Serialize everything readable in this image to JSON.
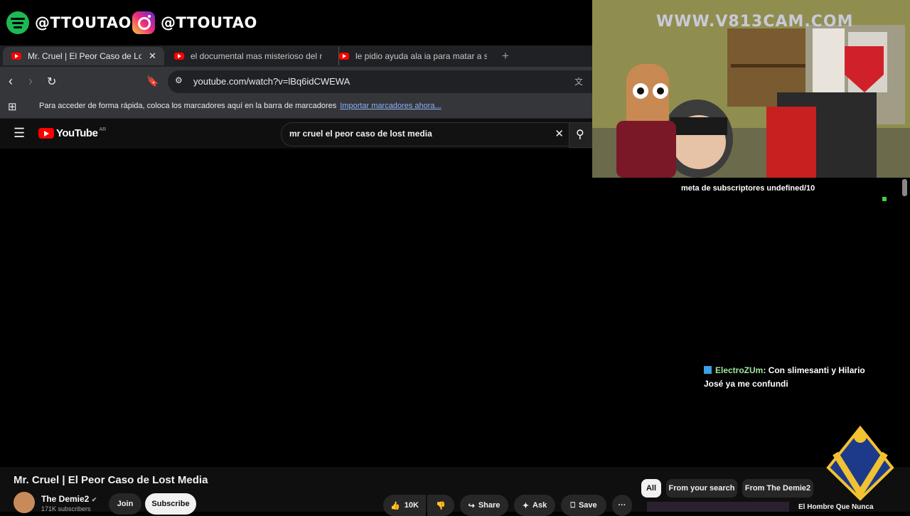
{
  "overlay": {
    "spotify_handle": "@TTOUTAO",
    "instagram_handle": "@TTOUTAO",
    "webcam_watermark": "WWW.V813CAM.COM",
    "sub_goal": "meta de subscriptores undefined/10"
  },
  "browser": {
    "tabs": [
      {
        "title": "Mr. Cruel | El Peor Caso de Lost M",
        "active": true
      },
      {
        "title": "el documental mas misterioso del m",
        "active": false
      },
      {
        "title": "le pidio ayuda ala ia para matar a su",
        "active": false
      }
    ],
    "new_tab": "+",
    "url": "youtube.com/watch?v=lBq6idCWEWA",
    "bookmarks_hint": "Para acceder de forma rápida, coloca los marcadores aquí en la barra de marcadores",
    "bookmarks_import": "Importar marcadores ahora..."
  },
  "youtube": {
    "logo_text": "YouTube",
    "logo_region": "AR",
    "search_query": "mr cruel el peor caso de lost media",
    "video_title": "Mr. Cruel | El Peor Caso de Lost Media",
    "channel_name": "The Demie2",
    "subscribers": "171K subscribers",
    "join_label": "Join",
    "subscribe_label": "Subscribe",
    "like_count": "10K",
    "share_label": "Share",
    "ask_label": "Ask",
    "save_label": "Save",
    "more_label": "···",
    "chips": [
      "All",
      "From your search",
      "From The Demie2"
    ],
    "rec_title": "El Hombre Que Nunca"
  },
  "chat": {
    "user": "ElectroZUm",
    "message": ": Con slimesanti y Hilario José ya me confundi"
  },
  "colors": {
    "yt_red": "#ff0000",
    "spotify_green": "#1db954",
    "chat_user": "#9fe89f",
    "link_blue": "#8ab4f8"
  }
}
